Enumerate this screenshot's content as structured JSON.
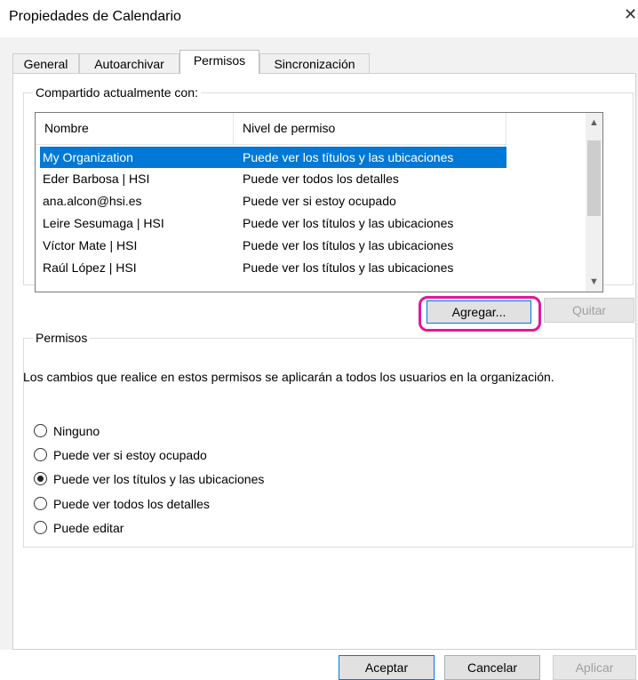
{
  "window": {
    "title": "Propiedades de Calendario",
    "close_glyph": "✕"
  },
  "tabs": [
    {
      "label": "General"
    },
    {
      "label": "Autoarchivar"
    },
    {
      "label": "Permisos"
    },
    {
      "label": "Sincronización"
    }
  ],
  "shared": {
    "group_label": "Compartido actualmente con:",
    "columns": {
      "name": "Nombre",
      "level": "Nivel de permiso"
    },
    "rows": [
      {
        "name": "My Organization",
        "level": "Puede ver los títulos y las ubicaciones",
        "selected": true
      },
      {
        "name": "Eder Barbosa | HSI",
        "level": "Puede ver todos los detalles"
      },
      {
        "name": "ana.alcon@hsi.es",
        "level": "Puede ver si estoy ocupado"
      },
      {
        "name": "Leire Sesumaga | HSI",
        "level": "Puede ver los títulos y las ubicaciones"
      },
      {
        "name": "Víctor Mate | HSI",
        "level": "Puede ver los títulos y las ubicaciones"
      },
      {
        "name": "Raúl López | HSI",
        "level": "Puede ver los títulos y las ubicaciones"
      }
    ],
    "add_label": "Agregar...",
    "remove_label": "Quitar"
  },
  "permissions": {
    "group_label": "Permisos",
    "description": "Los cambios que realice en estos permisos se aplicarán a todos los usuarios en la organización.",
    "options": [
      {
        "label": "Ninguno",
        "checked": false
      },
      {
        "label": "Puede ver si estoy ocupado",
        "checked": false
      },
      {
        "label": "Puede ver los títulos y las ubicaciones",
        "checked": true
      },
      {
        "label": "Puede ver todos los detalles",
        "checked": false
      },
      {
        "label": "Puede editar",
        "checked": false
      }
    ]
  },
  "footer": {
    "ok_label": "Aceptar",
    "cancel_label": "Cancelar",
    "apply_label": "Aplicar"
  },
  "colors": {
    "selection": "#0078d7",
    "highlight": "#e0189a"
  }
}
